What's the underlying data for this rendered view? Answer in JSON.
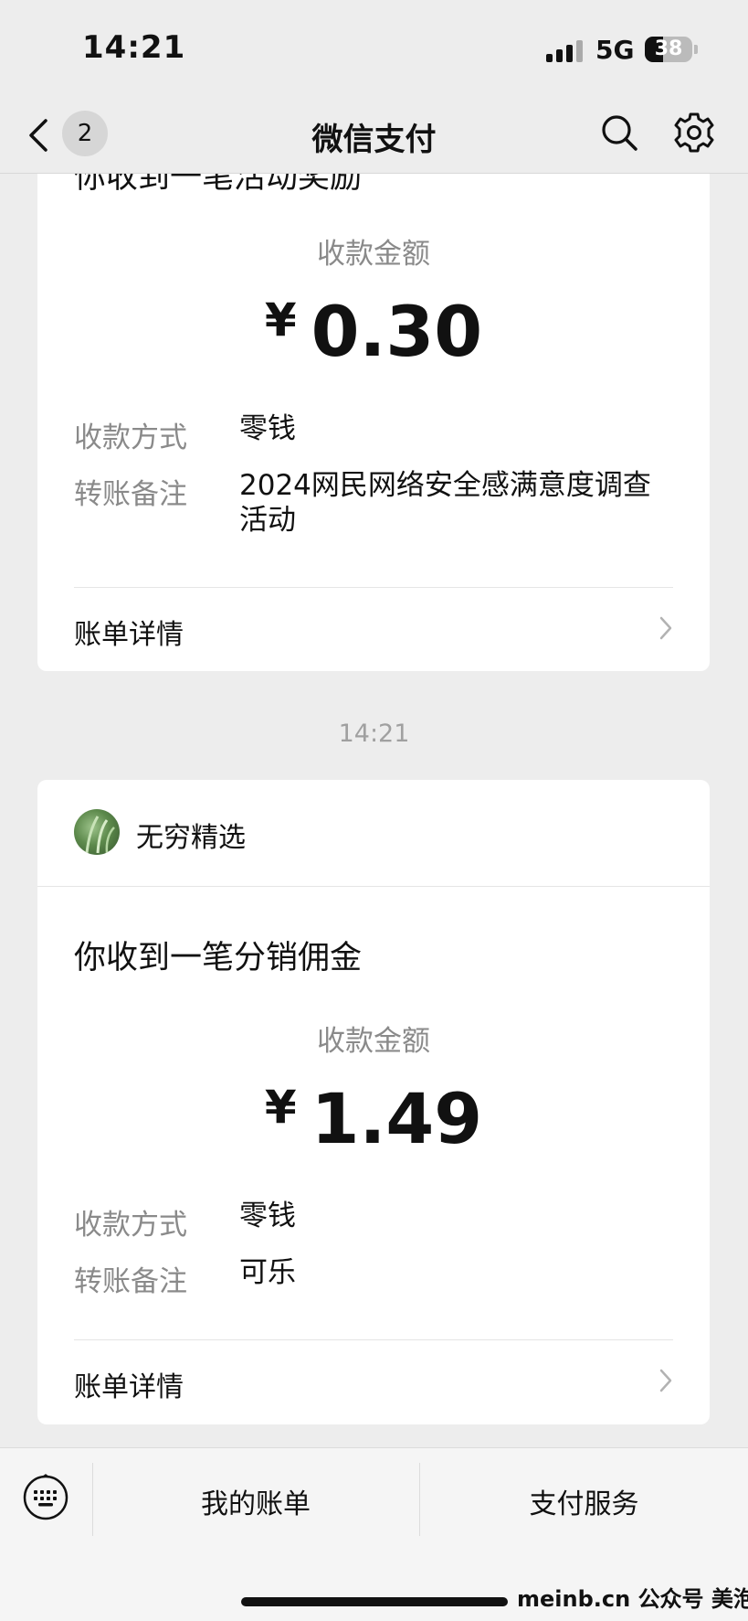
{
  "status_bar": {
    "time": "14:21",
    "network": "5G",
    "battery": "38",
    "battery_level": 0.38
  },
  "nav": {
    "back_badge": "2",
    "title": "微信支付"
  },
  "card_top": {
    "title_partial": "你收到一笔活动奖励",
    "amount_label": "收款金额",
    "currency": "¥",
    "amount": "0.30",
    "method_label": "收款方式",
    "method_value": "零钱",
    "note_label": "转账备注",
    "note_value": "2024网民网络安全感满意度调查活动",
    "detail_label": "账单详情"
  },
  "timestamp": "14:21",
  "card_bottom": {
    "merchant_name": "无穷精选",
    "title": "你收到一笔分销佣金",
    "amount_label": "收款金额",
    "currency": "¥",
    "amount": "1.49",
    "method_label": "收款方式",
    "method_value": "零钱",
    "note_label": "转账备注",
    "note_value": "可乐",
    "detail_label": "账单详情"
  },
  "bottom_bar": {
    "bill_label": "我的账单",
    "service_label": "支付服务"
  },
  "watermark": "meinb.cn  公众号 美泡君",
  "icons": {
    "back": "chevron-left-icon",
    "search": "search-icon",
    "settings": "gear-icon",
    "chevron": "chevron-right-icon",
    "keyboard": "keyboard-icon"
  },
  "colors": {
    "background": "#ededed",
    "card": "#ffffff",
    "secondary_text": "#8a8a8a"
  }
}
